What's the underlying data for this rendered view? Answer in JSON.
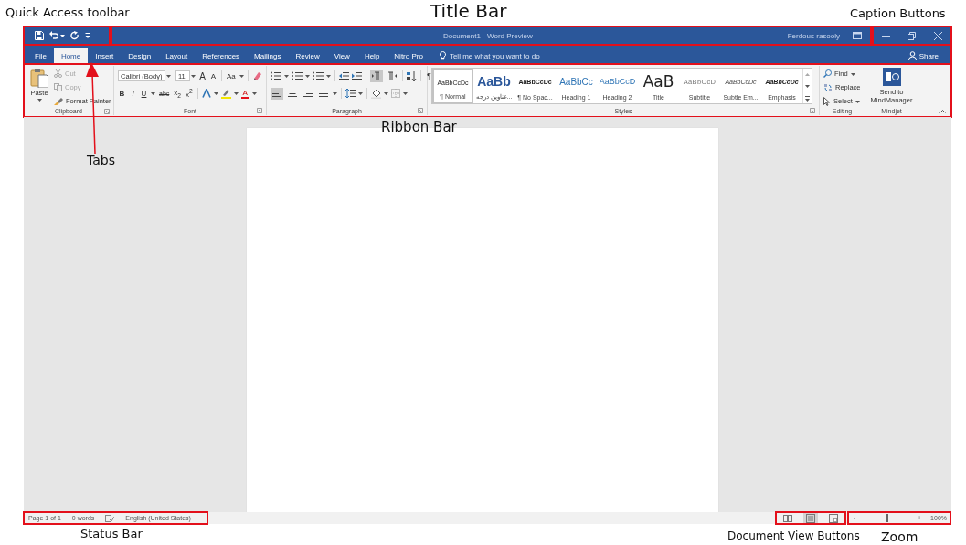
{
  "annotations": [
    {
      "text": "Quick Access toolbar"
    },
    {
      "text": "Title Bar"
    },
    {
      "text": "Caption Buttons"
    },
    {
      "text": "Ribbon Bar"
    },
    {
      "text": "Tabs"
    },
    {
      "text": "Status Bar"
    },
    {
      "text": "Document View Buttons"
    },
    {
      "text": "Zoom"
    }
  ],
  "title_bar": {
    "document_title": "Document1  -  Word Preview",
    "user": "Ferdous rasooly"
  },
  "tabs": [
    {
      "label": "File",
      "selected": false
    },
    {
      "label": "Home",
      "selected": true
    },
    {
      "label": "Insert",
      "selected": false
    },
    {
      "label": "Design",
      "selected": false
    },
    {
      "label": "Layout",
      "selected": false
    },
    {
      "label": "References",
      "selected": false
    },
    {
      "label": "Mailings",
      "selected": false
    },
    {
      "label": "Review",
      "selected": false
    },
    {
      "label": "View",
      "selected": false
    },
    {
      "label": "Help",
      "selected": false
    },
    {
      "label": "Nitro Pro",
      "selected": false
    }
  ],
  "tell_me": {
    "placeholder": "Tell me what you want to do"
  },
  "share": "Share",
  "ribbon": {
    "groups": [
      {
        "kind": "clipboard",
        "label": "Clipboard",
        "paste": "Paste",
        "commands": [
          {
            "label": "Cut",
            "disabled": true
          },
          {
            "label": "Copy",
            "disabled": true
          },
          {
            "label": "Format Painter",
            "disabled": false
          }
        ]
      },
      {
        "kind": "font",
        "label": "Font",
        "font_name": "Calibri (Body)",
        "font_size": "11",
        "size_buttons": [
          "A",
          "A"
        ],
        "change_case": "Aa",
        "format_buttons": [
          "B",
          "I",
          "U",
          "abc",
          "x$_{2}$",
          "x$^{2}$"
        ],
        "font_color": "A"
      },
      {
        "kind": "paragraph",
        "label": "Paragraph",
        "directions": [
          {
            "kind": "ltr",
            "selected": true
          },
          {
            "kind": "rtl",
            "selected": false
          }
        ],
        "pilcrow": "¶",
        "alignments": [
          {
            "kind": "left",
            "selected": true
          },
          {
            "kind": "center",
            "selected": false
          },
          {
            "kind": "right",
            "selected": false
          },
          {
            "kind": "justify",
            "selected": false
          }
        ]
      },
      {
        "kind": "styles",
        "label": "Styles",
        "styles": [
          {
            "kind": "normal",
            "preview": "AaBbCcDc",
            "name": "¶ Normal",
            "selected": true
          },
          {
            "kind": "heading_custom",
            "preview": "AaBb",
            "name": "عناوین درجه...",
            "selected": false
          },
          {
            "kind": "no_spacing",
            "preview": "AaBbCcDc",
            "name": "¶ No Spac...",
            "selected": false
          },
          {
            "kind": "heading1",
            "preview": "AaBbCc",
            "name": "Heading 1",
            "selected": false
          },
          {
            "kind": "heading2",
            "preview": "AaBbCcD",
            "name": "Heading 2",
            "selected": false
          },
          {
            "kind": "title",
            "preview": "AaB",
            "name": "Title",
            "selected": false
          },
          {
            "kind": "subtitle",
            "preview": "AaBbCcD",
            "name": "Subtitle",
            "selected": false
          },
          {
            "kind": "subtle_emphasis",
            "preview": "AaBbCcDc",
            "name": "Subtle Em...",
            "selected": false
          },
          {
            "kind": "emphasis",
            "preview": "AaBbCcDc",
            "name": "Emphasis",
            "selected": false
          }
        ]
      },
      {
        "kind": "editing",
        "label": "Editing",
        "commands": [
          "Find",
          "Replace",
          "Select"
        ]
      },
      {
        "kind": "mindjet",
        "label": "Mindjet",
        "command": "Send to MindManager"
      }
    ]
  },
  "status_bar": {
    "items": [
      "Page 1 of 1",
      "0 words",
      "English (United States)"
    ],
    "views": [
      {
        "kind": "read",
        "selected": false
      },
      {
        "kind": "print",
        "selected": true
      },
      {
        "kind": "web",
        "selected": false
      }
    ],
    "zoom": {
      "minus": "-",
      "plus": "+",
      "level": 0.5,
      "reading": "100%"
    }
  }
}
